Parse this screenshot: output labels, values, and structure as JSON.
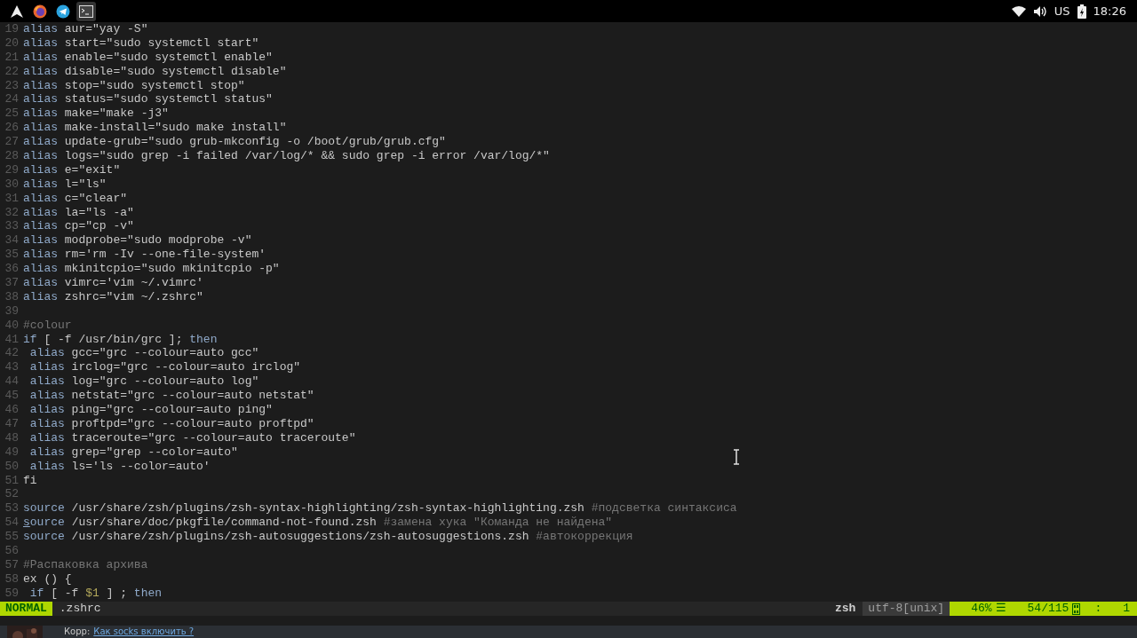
{
  "taskbar": {
    "apps": [
      {
        "kind": "arch",
        "selected": false
      },
      {
        "kind": "browser",
        "selected": false
      },
      {
        "kind": "messenger",
        "selected": false
      },
      {
        "kind": "terminal",
        "selected": true
      }
    ],
    "tray": {
      "keyboard_layout": "US",
      "time": "18:26"
    }
  },
  "editor": {
    "lines": [
      {
        "number": "19",
        "segments": [
          {
            "kind": "keyword",
            "text": "alias"
          },
          {
            "kind": "text",
            "text": " aur=\"yay -S\""
          }
        ]
      },
      {
        "number": "20",
        "segments": [
          {
            "kind": "keyword",
            "text": "alias"
          },
          {
            "kind": "text",
            "text": " start=\"sudo systemctl start\""
          }
        ]
      },
      {
        "number": "21",
        "segments": [
          {
            "kind": "keyword",
            "text": "alias"
          },
          {
            "kind": "text",
            "text": " enable=\"sudo systemctl enable\""
          }
        ]
      },
      {
        "number": "22",
        "segments": [
          {
            "kind": "keyword",
            "text": "alias"
          },
          {
            "kind": "text",
            "text": " disable=\"sudo systemctl disable\""
          }
        ]
      },
      {
        "number": "23",
        "segments": [
          {
            "kind": "keyword",
            "text": "alias"
          },
          {
            "kind": "text",
            "text": " stop=\"sudo systemctl stop\""
          }
        ]
      },
      {
        "number": "24",
        "segments": [
          {
            "kind": "keyword",
            "text": "alias"
          },
          {
            "kind": "text",
            "text": " status=\"sudo systemctl status\""
          }
        ]
      },
      {
        "number": "25",
        "segments": [
          {
            "kind": "keyword",
            "text": "alias"
          },
          {
            "kind": "text",
            "text": " make=\"make -j3\""
          }
        ]
      },
      {
        "number": "26",
        "segments": [
          {
            "kind": "keyword",
            "text": "alias"
          },
          {
            "kind": "text",
            "text": " make-install=\"sudo make install\""
          }
        ]
      },
      {
        "number": "27",
        "segments": [
          {
            "kind": "keyword",
            "text": "alias"
          },
          {
            "kind": "text",
            "text": " update-grub=\"sudo grub-mkconfig -o /boot/grub/grub.cfg\""
          }
        ]
      },
      {
        "number": "28",
        "segments": [
          {
            "kind": "keyword",
            "text": "alias"
          },
          {
            "kind": "text",
            "text": " logs=\"sudo grep -i failed /var/log/* && sudo grep -i error /var/log/*\""
          }
        ]
      },
      {
        "number": "29",
        "segments": [
          {
            "kind": "keyword",
            "text": "alias"
          },
          {
            "kind": "text",
            "text": " e=\"exit\""
          }
        ]
      },
      {
        "number": "30",
        "segments": [
          {
            "kind": "keyword",
            "text": "alias"
          },
          {
            "kind": "text",
            "text": " l=\"ls\""
          }
        ]
      },
      {
        "number": "31",
        "segments": [
          {
            "kind": "keyword",
            "text": "alias"
          },
          {
            "kind": "text",
            "text": " c=\"clear\""
          }
        ]
      },
      {
        "number": "32",
        "segments": [
          {
            "kind": "keyword",
            "text": "alias"
          },
          {
            "kind": "text",
            "text": " la=\"ls -a\""
          }
        ]
      },
      {
        "number": "33",
        "segments": [
          {
            "kind": "keyword",
            "text": "alias"
          },
          {
            "kind": "text",
            "text": " cp=\"cp -v\""
          }
        ]
      },
      {
        "number": "34",
        "segments": [
          {
            "kind": "keyword",
            "text": "alias"
          },
          {
            "kind": "text",
            "text": " modprobe=\"sudo modprobe -v\""
          }
        ]
      },
      {
        "number": "35",
        "segments": [
          {
            "kind": "keyword",
            "text": "alias"
          },
          {
            "kind": "text",
            "text": " rm='rm -Iv --one-file-system'"
          }
        ]
      },
      {
        "number": "36",
        "segments": [
          {
            "kind": "keyword",
            "text": "alias"
          },
          {
            "kind": "text",
            "text": " mkinitcpio=\"sudo mkinitcpio -p\""
          }
        ]
      },
      {
        "number": "37",
        "segments": [
          {
            "kind": "keyword",
            "text": "alias"
          },
          {
            "kind": "text",
            "text": " vimrc='vim ~/.vimrc'"
          }
        ]
      },
      {
        "number": "38",
        "segments": [
          {
            "kind": "keyword",
            "text": "alias"
          },
          {
            "kind": "text",
            "text": " zshrc=\"vim ~/.zshrc\""
          }
        ]
      },
      {
        "number": "39"
      },
      {
        "number": "40",
        "segments": [
          {
            "kind": "comment",
            "text": "#colour"
          }
        ]
      },
      {
        "number": "41",
        "segments": [
          {
            "kind": "keyword",
            "text": "if"
          },
          {
            "kind": "text",
            "text": " [ -f /usr/bin/grc ]; "
          },
          {
            "kind": "keyword",
            "text": "then"
          }
        ]
      },
      {
        "number": "42",
        "segments": [
          {
            "kind": "keyword",
            "text": " alias"
          },
          {
            "kind": "text",
            "text": " gcc=\"grc --colour=auto gcc\""
          }
        ]
      },
      {
        "number": "43",
        "segments": [
          {
            "kind": "keyword",
            "text": " alias"
          },
          {
            "kind": "text",
            "text": " irclog=\"grc --colour=auto irclog\""
          }
        ]
      },
      {
        "number": "44",
        "segments": [
          {
            "kind": "keyword",
            "text": " alias"
          },
          {
            "kind": "text",
            "text": " log=\"grc --colour=auto log\""
          }
        ]
      },
      {
        "number": "45",
        "segments": [
          {
            "kind": "keyword",
            "text": " alias"
          },
          {
            "kind": "text",
            "text": " netstat=\"grc --colour=auto netstat\""
          }
        ]
      },
      {
        "number": "46",
        "segments": [
          {
            "kind": "keyword",
            "text": " alias"
          },
          {
            "kind": "text",
            "text": " ping=\"grc --colour=auto ping\""
          }
        ]
      },
      {
        "number": "47",
        "segments": [
          {
            "kind": "keyword",
            "text": " alias"
          },
          {
            "kind": "text",
            "text": " proftpd=\"grc --colour=auto proftpd\""
          }
        ]
      },
      {
        "number": "48",
        "segments": [
          {
            "kind": "keyword",
            "text": " alias"
          },
          {
            "kind": "text",
            "text": " traceroute=\"grc --colour=auto traceroute\""
          }
        ]
      },
      {
        "number": "49",
        "segments": [
          {
            "kind": "keyword",
            "text": " alias"
          },
          {
            "kind": "text",
            "text": " grep=\"grep --color=auto\""
          }
        ]
      },
      {
        "number": "50",
        "segments": [
          {
            "kind": "keyword",
            "text": " alias"
          },
          {
            "kind": "text",
            "text": " ls='ls --color=auto'"
          }
        ]
      },
      {
        "number": "51",
        "segments": [
          {
            "kind": "text",
            "text": "fi"
          }
        ]
      },
      {
        "number": "52"
      },
      {
        "number": "53",
        "segments": [
          {
            "kind": "keyword",
            "text": "source"
          },
          {
            "kind": "text",
            "text": " /usr/share/zsh/plugins/zsh-syntax-highlighting/zsh-syntax-highlighting.zsh "
          },
          {
            "kind": "comment",
            "text": "#подсветка синтаксиса"
          }
        ]
      },
      {
        "number": "54",
        "segments": [
          {
            "kind": "cursor",
            "text": "s"
          },
          {
            "kind": "keyword",
            "text": "ource"
          },
          {
            "kind": "text",
            "text": " /usr/share/doc/pkgfile/command-not-found.zsh "
          },
          {
            "kind": "comment",
            "text": "#замена хука \"Команда не найдена\""
          }
        ]
      },
      {
        "number": "55",
        "segments": [
          {
            "kind": "keyword",
            "text": "source"
          },
          {
            "kind": "text",
            "text": " /usr/share/zsh/plugins/zsh-autosuggestions/zsh-autosuggestions.zsh "
          },
          {
            "kind": "comment",
            "text": "#автокоррекция"
          }
        ]
      },
      {
        "number": "56"
      },
      {
        "number": "57",
        "segments": [
          {
            "kind": "comment",
            "text": "#Распаковка архива"
          }
        ]
      },
      {
        "number": "58",
        "segments": [
          {
            "kind": "text",
            "text": "ex () {"
          }
        ]
      },
      {
        "number": "59",
        "segments": [
          {
            "kind": "keyword",
            "text": " if"
          },
          {
            "kind": "text",
            "text": " [ -f "
          },
          {
            "kind": "variable",
            "text": "$1"
          },
          {
            "kind": "text",
            "text": " ] ; "
          },
          {
            "kind": "keyword",
            "text": "then"
          }
        ]
      }
    ]
  },
  "status_line": {
    "mode": "NORMAL",
    "file": ".zshrc",
    "filetype": "zsh",
    "encoding": "utf-8[unix]",
    "percent": "46%",
    "percent_symbol": "☰",
    "position": "54/115",
    "column_separator": ":",
    "column": "1"
  },
  "notification": {
    "author": "Корр:",
    "message": "Как socks включить ?"
  }
}
